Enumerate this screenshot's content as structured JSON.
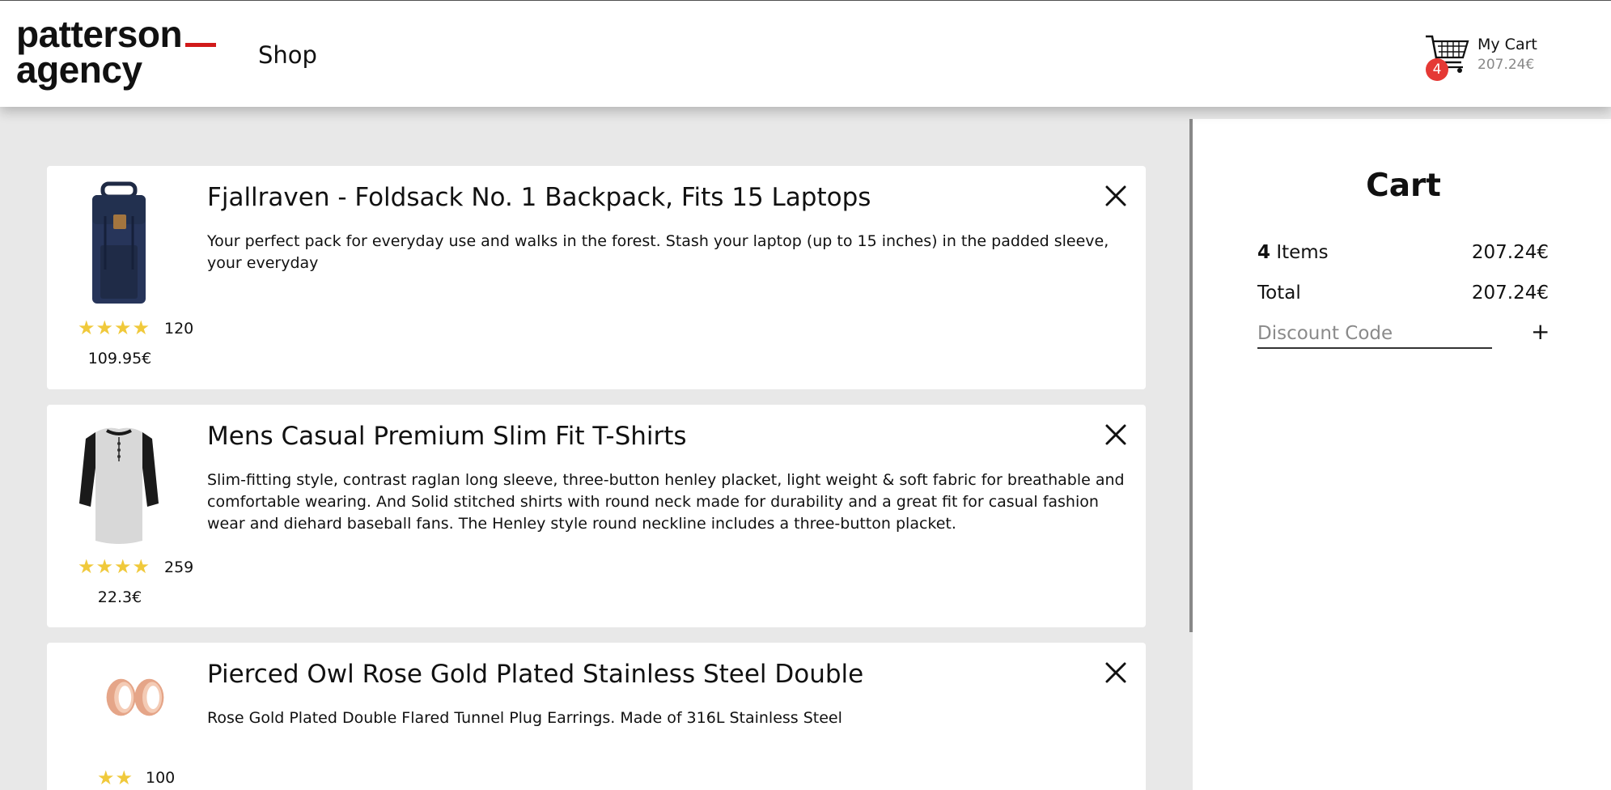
{
  "header": {
    "logo_line1": "patterson",
    "logo_line2": "agency",
    "nav_shop": "Shop",
    "cart_label": "My Cart",
    "cart_total": "207.24€",
    "cart_count": "4"
  },
  "cart": {
    "title": "Cart",
    "items_count": "4",
    "items_word": "Items",
    "items_amount": "207.24€",
    "total_label": "Total",
    "total_amount": "207.24€",
    "discount_placeholder": "Discount Code",
    "add_discount_label": "+"
  },
  "products": [
    {
      "title": "Fjallraven - Foldsack No. 1 Backpack, Fits 15 Laptops",
      "description": "Your perfect pack for everyday use and walks in the forest. Stash your laptop (up to 15 inches) in the padded sleeve, your everyday",
      "stars": "★★★★",
      "rating_count": "120",
      "price": "109.95€",
      "image_icon": "backpack-image"
    },
    {
      "title": "Mens Casual Premium Slim Fit T-Shirts",
      "description": "Slim-fitting style, contrast raglan long sleeve, three-button henley placket, light weight & soft fabric for breathable and comfortable wearing. And Solid stitched shirts with round neck made for durability and a great fit for casual fashion wear and diehard baseball fans. The Henley style round neckline includes a three-button placket.",
      "stars": "★★★★",
      "rating_count": "259",
      "price": "22.3€",
      "image_icon": "tshirt-image"
    },
    {
      "title": "Pierced Owl Rose Gold Plated Stainless Steel Double",
      "description": "Rose Gold Plated Double Flared Tunnel Plug Earrings. Made of 316L Stainless Steel",
      "stars": "★★",
      "rating_count": "100",
      "price": "",
      "image_icon": "earrings-image"
    }
  ],
  "colors": {
    "accent": "#d11a1a",
    "badge": "#e53935",
    "star": "#f0c93b",
    "background": "#e8e8e8"
  }
}
